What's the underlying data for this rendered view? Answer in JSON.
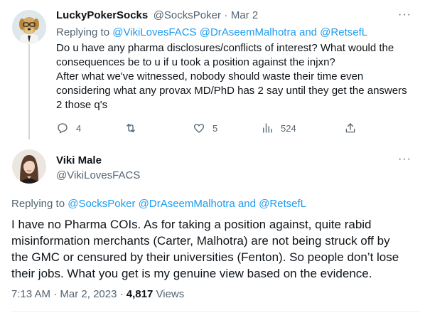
{
  "tweet1": {
    "name": "LuckyPokerSocks",
    "handle": "@SocksPoker",
    "separator": "·",
    "date": "Mar 2",
    "replying_prefix": "Replying to",
    "replying_handles": "@VikiLovesFACS @DrAseemMalhotra and @RetsefL",
    "text_lines": [
      "Do u have any pharma disclosures/conflicts of interest? What would the",
      "consequences be to u if u took a position against the injxn?",
      "After what we've witnessed, nobody should waste their time even",
      "considering what any provax MD/PhD has 2 say until they get the answers",
      "2 those q's"
    ],
    "actions": {
      "reply_count": "4",
      "retweet_count": "",
      "like_count": "5",
      "views_count": "524"
    },
    "more_label": "···"
  },
  "tweet2": {
    "name": "Viki Male",
    "handle": "@VikiLovesFACS",
    "more_label": "···",
    "replying_prefix": "Replying to",
    "replying_handles": "@SocksPoker @DrAseemMalhotra and @RetsefL",
    "text_lines": [
      "I have no Pharma COIs. As for taking a position against, quite rabid",
      "misinformation merchants (Carter, Malhotra) are not being struck off by",
      "the GMC or censured by their universities (Fenton). So people don’t lose",
      "their jobs. What you get is my genuine view based on the evidence."
    ],
    "time": "7:13 AM",
    "dot": "·",
    "date": "Mar 2, 2023",
    "dot2": "·",
    "views": "4,817",
    "views_label": "Views"
  },
  "colors": {
    "link_blue": "#1d9bf0",
    "muted_gray": "#536471",
    "text": "#0f1419",
    "thread_line": "#cfd9de"
  },
  "icons": [
    "dog-avatar-icon",
    "reply-icon",
    "retweet-icon",
    "like-icon",
    "views-icon",
    "share-icon",
    "more-icon",
    "woman-avatar-icon"
  ]
}
